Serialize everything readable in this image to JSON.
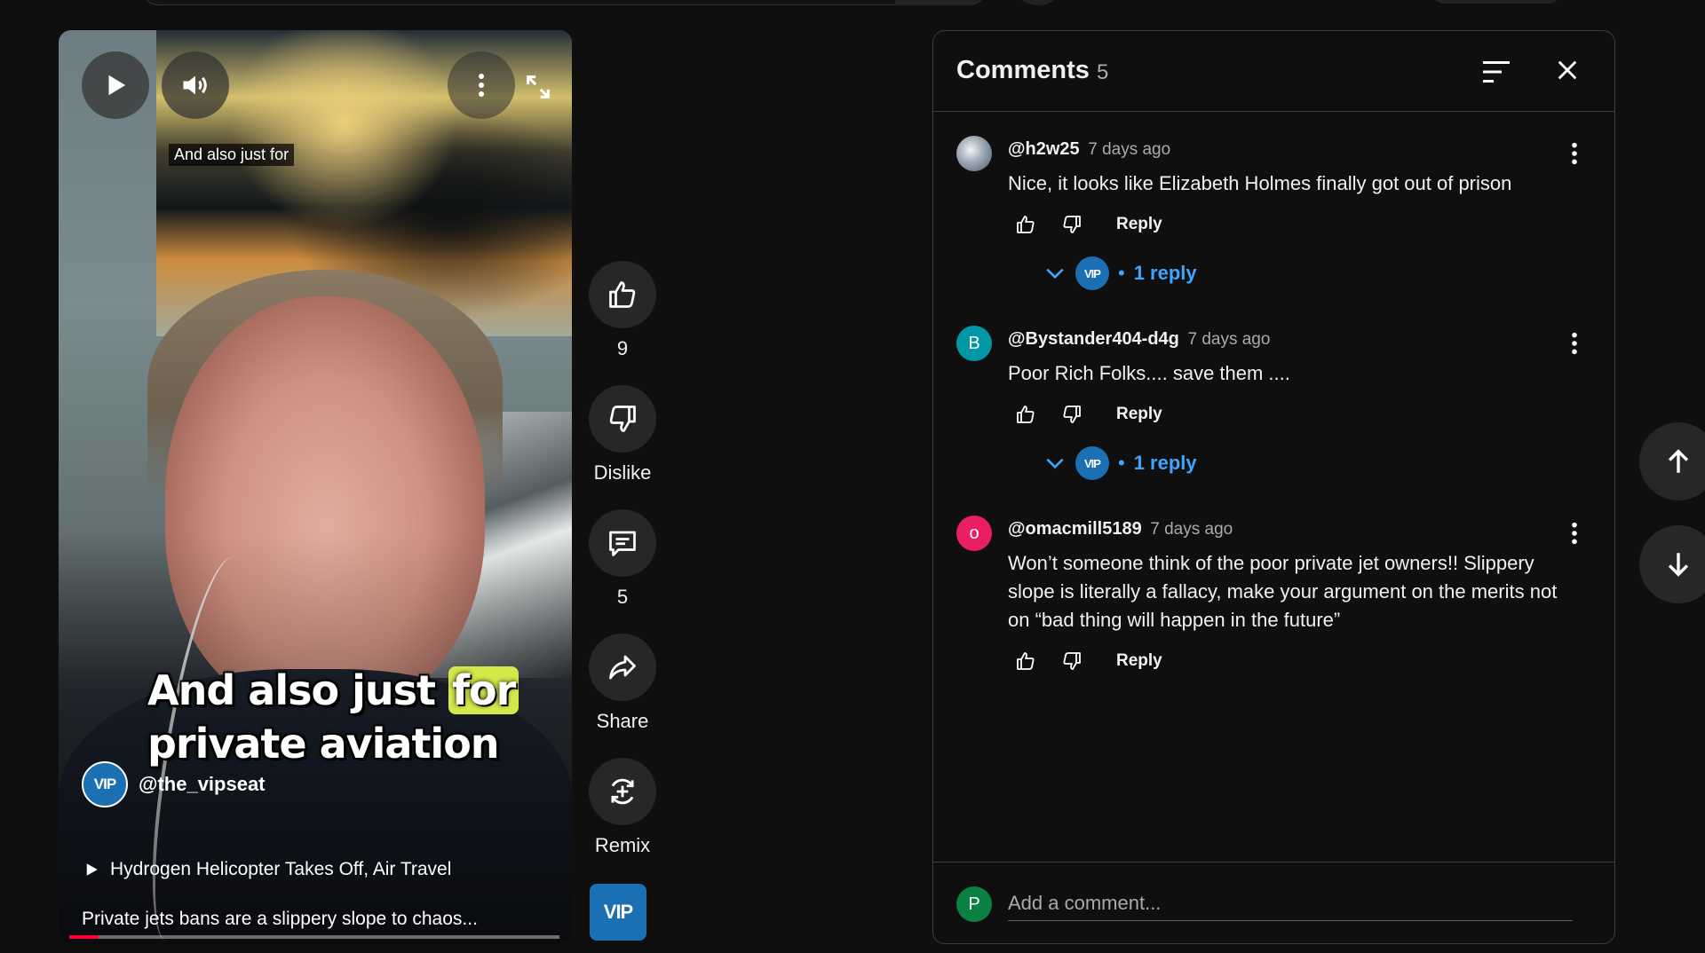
{
  "video": {
    "caption_small": "And also just for",
    "caption_big_line1_a": "And also just ",
    "caption_big_highlight": "for",
    "caption_big_line2": "private aviation",
    "channel_handle": "@the_vipseat",
    "channel_logo_text": "VIP",
    "suggestion_title": "Hydrogen Helicopter Takes Off, Air Travel",
    "description": "Private jets bans are a slippery slope to chaos...",
    "progress_fraction": 0.06,
    "accent_color": "#ff0033"
  },
  "rail": {
    "like_count": "9",
    "dislike_label": "Dislike",
    "comments_count": "5",
    "share_label": "Share",
    "remix_label": "Remix",
    "channel_logo_text": "VIP"
  },
  "comments_panel": {
    "title": "Comments",
    "count": "5",
    "comments": [
      {
        "author": "@h2w25",
        "time": "7 days ago",
        "text": "Nice, it looks like Elizabeth Holmes finally got out of prison",
        "reply_label": "Reply",
        "replies_label": "1 reply",
        "avatar_initial": "",
        "avatar_color": "#9aa7b3"
      },
      {
        "author": "@Bystander404-d4g",
        "time": "7 days ago",
        "text": "Poor Rich Folks.... save them ....",
        "reply_label": "Reply",
        "replies_label": "1 reply",
        "avatar_initial": "B",
        "avatar_color": "#0097a7"
      },
      {
        "author": "@omacmill5189",
        "time": "7 days ago",
        "text": "Won’t someone think of the poor private jet owners!! Slippery slope is literally a fallacy, make your argument on the merits not on “bad thing will happen in the future”",
        "reply_label": "Reply",
        "avatar_initial": "o",
        "avatar_color": "#e91e63"
      }
    ],
    "add_comment_placeholder": "Add a comment...",
    "user_avatar_initial": "P",
    "reply_accent_color": "#3ea6ff"
  }
}
